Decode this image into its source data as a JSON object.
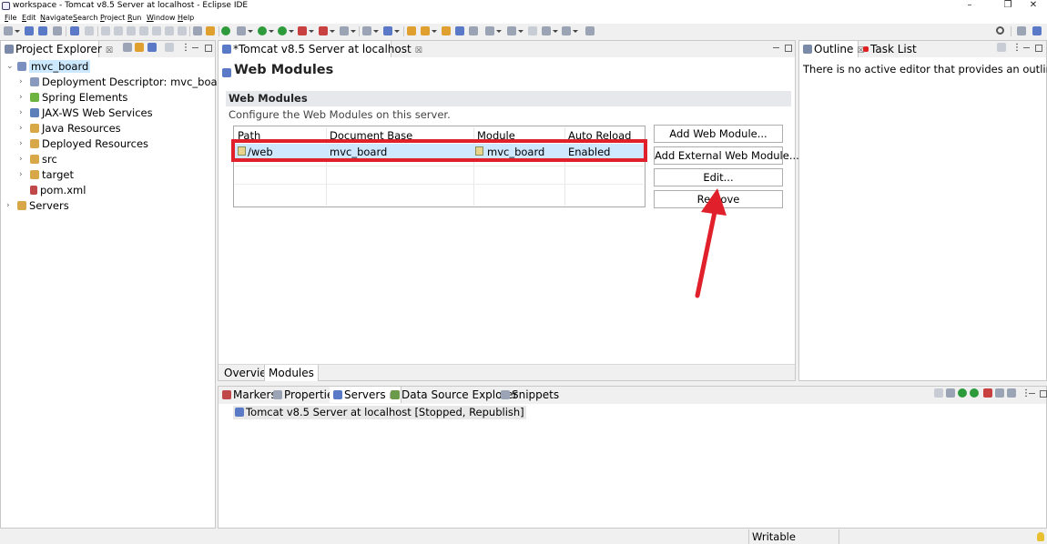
{
  "window": {
    "title": "workspace - Tomcat v8.5 Server at localhost - Eclipse IDE",
    "minimize": "–",
    "restore": "❐",
    "close": "✕"
  },
  "menu": [
    "File",
    "Edit",
    "Navigate",
    "Search",
    "Project",
    "Run",
    "Window",
    "Help"
  ],
  "project_explorer": {
    "tab_label": "Project Explorer",
    "tab_close": "☒",
    "root": "mvc_board",
    "items": [
      "Deployment Descriptor: mvc_board",
      "Spring Elements",
      "JAX-WS Web Services",
      "Java Resources",
      "Deployed Resources",
      "src",
      "target",
      "pom.xml"
    ],
    "servers": "Servers"
  },
  "editor": {
    "tab_label": "*Tomcat v8.5 Server at localhost",
    "tab_close": "☒",
    "page_title": "Web Modules",
    "section_title": "Web Modules",
    "section_desc": "Configure the Web Modules on this server.",
    "columns": [
      "Path",
      "Document Base",
      "Module",
      "Auto Reload"
    ],
    "rows": [
      {
        "path": "/web",
        "doc_base": "mvc_board",
        "module": "mvc_board",
        "auto_reload": "Enabled"
      }
    ],
    "buttons": {
      "add_web_module": "Add Web Module...",
      "add_external": "Add External Web Module...",
      "edit": "Edit...",
      "remove": "Remove"
    },
    "bottom_tabs": [
      "Overview",
      "Modules"
    ]
  },
  "outline": {
    "tab_label": "Outline",
    "tab_close": "☒",
    "task_list_label": "Task List",
    "message": "There is no active editor that provides an outline."
  },
  "bottom_panel": {
    "tabs": [
      "Markers",
      "Properties",
      "Servers",
      "Data Source Explorer",
      "Snippets"
    ],
    "servers_close": "☒",
    "server_entry": "Tomcat v8.5 Server at localhost  [Stopped, Republish]"
  },
  "status": {
    "writable": "Writable"
  },
  "colors": {
    "highlight_box": "#e0202a",
    "arrow": "#e0202a",
    "selection": "#cde8ff"
  }
}
